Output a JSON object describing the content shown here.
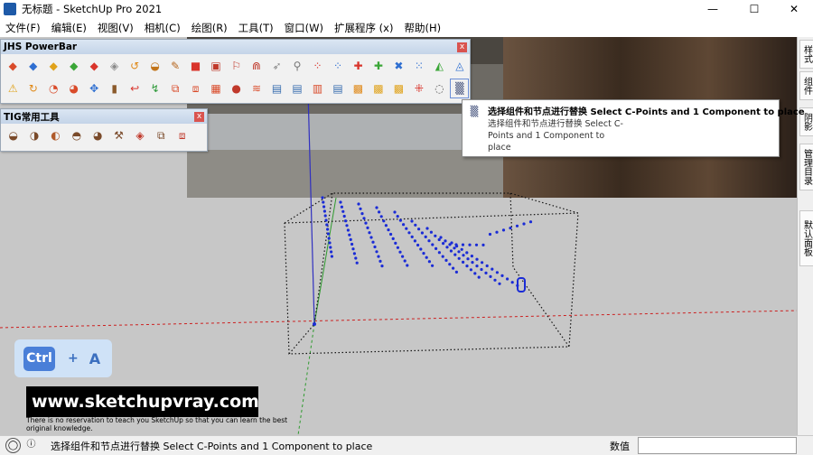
{
  "window": {
    "title": "无标题 - SketchUp Pro 2021",
    "minimize_glyph": "—",
    "maximize_glyph": "☐",
    "close_glyph": "✕"
  },
  "menubar": [
    "文件(F)",
    "编辑(E)",
    "视图(V)",
    "相机(C)",
    "绘图(R)",
    "工具(T)",
    "窗口(W)",
    "扩展程序 (x)",
    "帮助(H)"
  ],
  "jhs_toolbar": {
    "title": "JHS PowerBar",
    "close_glyph": "x",
    "row1_icons": [
      {
        "name": "push-pull-plane-icon",
        "glyph": "◆",
        "color": "#d94b2a"
      },
      {
        "name": "surface-blue-icon",
        "glyph": "◆",
        "color": "#2f6fd1"
      },
      {
        "name": "surface-yellow-icon",
        "glyph": "◆",
        "color": "#e0a21a"
      },
      {
        "name": "surface-green-icon",
        "glyph": "◆",
        "color": "#3aa637"
      },
      {
        "name": "surface-red-icon",
        "glyph": "◆",
        "color": "#d9342b"
      },
      {
        "name": "surface-gray-icon",
        "glyph": "◈",
        "color": "#8a8a8a"
      },
      {
        "name": "curve-orange-icon",
        "glyph": "↺",
        "color": "#e08a1a"
      },
      {
        "name": "arc-tool-icon",
        "glyph": "◒",
        "color": "#c2741a"
      },
      {
        "name": "paint-brush-icon",
        "glyph": "✎",
        "color": "#b5651d"
      },
      {
        "name": "square-red-icon",
        "glyph": "■",
        "color": "#d9342b"
      },
      {
        "name": "square-outline-icon",
        "glyph": "▣",
        "color": "#c0392b"
      },
      {
        "name": "flag-icon",
        "glyph": "⚐",
        "color": "#c0392b"
      },
      {
        "name": "magnet-icon",
        "glyph": "⋒",
        "color": "#c0392b"
      },
      {
        "name": "tube-icon",
        "glyph": "➶",
        "color": "#888888"
      },
      {
        "name": "pipe-icon",
        "glyph": "⚲",
        "color": "#777777"
      },
      {
        "name": "dotted-arc-icon",
        "glyph": "⁘",
        "color": "#d9342b"
      },
      {
        "name": "dotted-curve-icon",
        "glyph": "⁘",
        "color": "#2f6fd1"
      },
      {
        "name": "cross-red-icon",
        "glyph": "✚",
        "color": "#d9342b"
      },
      {
        "name": "cross-green-icon",
        "glyph": "✚",
        "color": "#3aa637"
      },
      {
        "name": "x-blue-icon",
        "glyph": "✖",
        "color": "#2f6fd1"
      },
      {
        "name": "grid-dots-icon",
        "glyph": "⁙",
        "color": "#2f6fd1"
      },
      {
        "name": "cone-icon",
        "glyph": "◭",
        "color": "#3aa637"
      },
      {
        "name": "layers-icon",
        "glyph": "◬",
        "color": "#2f6fd1"
      }
    ],
    "row2_icons": [
      {
        "name": "warning-triangle-icon",
        "glyph": "⚠",
        "color": "#e0a21a"
      },
      {
        "name": "rotate-icon",
        "glyph": "↻",
        "color": "#e08a1a"
      },
      {
        "name": "shape-icon",
        "glyph": "◔",
        "color": "#d94b2a"
      },
      {
        "name": "shape2-icon",
        "glyph": "◕",
        "color": "#d94b2a"
      },
      {
        "name": "move-icon",
        "glyph": "✥",
        "color": "#2f6fd1"
      },
      {
        "name": "cylinder-icon",
        "glyph": "▮",
        "color": "#8b5a2b"
      },
      {
        "name": "loop-icon",
        "glyph": "↩",
        "color": "#d9342b"
      },
      {
        "name": "bend-icon",
        "glyph": "↯",
        "color": "#2f9a3a"
      },
      {
        "name": "box-split-icon",
        "glyph": "⧉",
        "color": "#d94b2a"
      },
      {
        "name": "box-push-icon",
        "glyph": "⧈",
        "color": "#d94b2a"
      },
      {
        "name": "box-3d-icon",
        "glyph": "▦",
        "color": "#d94b2a"
      },
      {
        "name": "sphere-icon",
        "glyph": "●",
        "color": "#c0392b"
      },
      {
        "name": "chevrons-icon",
        "glyph": "≋",
        "color": "#d94b2a"
      },
      {
        "name": "panel-a-icon",
        "glyph": "▤",
        "color": "#3a6fb0"
      },
      {
        "name": "panel-b-icon",
        "glyph": "▤",
        "color": "#3a6fb0"
      },
      {
        "name": "panel-c-icon",
        "glyph": "▥",
        "color": "#d94b2a"
      },
      {
        "name": "panel-d-icon",
        "glyph": "▤",
        "color": "#3a6fb0"
      },
      {
        "name": "square-yellow-icon",
        "glyph": "▩",
        "color": "#e08a1a"
      },
      {
        "name": "square-orange-icon",
        "glyph": "▩",
        "color": "#e0a21a"
      },
      {
        "name": "square-amber-icon",
        "glyph": "▩",
        "color": "#e0a21a"
      },
      {
        "name": "scatter-x-icon",
        "glyph": "⁜",
        "color": "#d9342b"
      },
      {
        "name": "dotted-circle-icon",
        "glyph": "◌",
        "color": "#555555"
      },
      {
        "name": "select-replace-icon",
        "glyph": "▒",
        "color": "#2a3a6a"
      }
    ]
  },
  "tig_toolbar": {
    "title": "TIG常用工具",
    "close_glyph": "x",
    "icons": [
      {
        "name": "tig-tool-1-icon",
        "glyph": "◒",
        "color": "#7a4a2a"
      },
      {
        "name": "tig-tool-2-icon",
        "glyph": "◑",
        "color": "#7a4a2a"
      },
      {
        "name": "tig-tool-3-icon",
        "glyph": "◐",
        "color": "#b05a2a"
      },
      {
        "name": "tig-tool-4-icon",
        "glyph": "◓",
        "color": "#7a4a2a"
      },
      {
        "name": "tig-tool-5-icon",
        "glyph": "◕",
        "color": "#7a4a2a"
      },
      {
        "name": "tig-tool-6-icon",
        "glyph": "⚒",
        "color": "#7a4a2a"
      },
      {
        "name": "tig-tool-7-icon",
        "glyph": "◈",
        "color": "#c0392b"
      },
      {
        "name": "tig-tool-8-icon",
        "glyph": "⧉",
        "color": "#7a4a2a"
      },
      {
        "name": "tig-tool-9-icon",
        "glyph": "⧈",
        "color": "#c0392b"
      }
    ]
  },
  "tooltip": {
    "heading": "选择组件和节点进行替换 Select C-Points and 1 Component to place",
    "body": "选择组件和节点进行替换 Select C-Points and 1 Component to place",
    "icon_glyph": "▒"
  },
  "right_panel_tabs": [
    "样式",
    "组件",
    "阴影",
    "管理目录",
    "默认面板"
  ],
  "shortcut_overlay": {
    "key1": "Ctrl",
    "plus": "+",
    "key2": "A"
  },
  "watermark": {
    "url": "www.sketchupvray.com",
    "subtitle": "There is no reservation to teach you SketchUp so that you can learn the best original knowledge."
  },
  "statusbar": {
    "info_glyph": "ⓘ",
    "message": "选择组件和节点进行替换 Select C-Points and 1 Component to place",
    "value_label": "数值",
    "value": ""
  },
  "colors": {
    "titlebar_bg": "#ffffff",
    "toolbar_head": "#c4d4e8",
    "point_blue": "#1a2bd6",
    "axis_red": "#cc2020",
    "axis_green": "#2e9a2e",
    "axis_blue": "#3030c0"
  }
}
